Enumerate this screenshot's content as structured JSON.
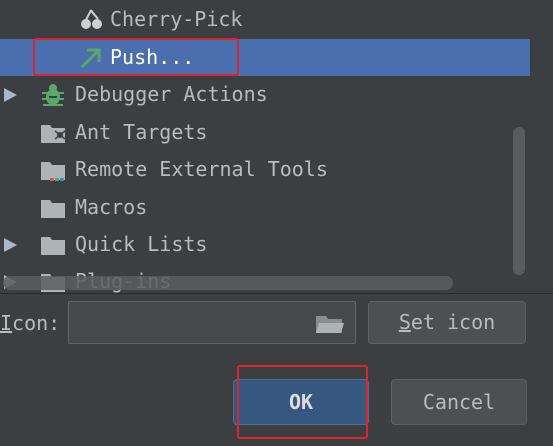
{
  "tree": {
    "items": [
      {
        "label": "Cherry-Pick",
        "icon": "cherry-icon",
        "expandable": false,
        "selected": false
      },
      {
        "label": "Push...",
        "icon": "push-arrow-icon",
        "expandable": false,
        "selected": true
      },
      {
        "label": "Debugger Actions",
        "icon": "bug-icon",
        "expandable": true,
        "selected": false
      },
      {
        "label": "Ant Targets",
        "icon": "ant-folder-icon",
        "expandable": false,
        "selected": false
      },
      {
        "label": "Remote External Tools",
        "icon": "external-tools-folder-icon",
        "expandable": false,
        "selected": false
      },
      {
        "label": "Macros",
        "icon": "folder-icon",
        "expandable": false,
        "selected": false
      },
      {
        "label": "Quick Lists",
        "icon": "folder-icon",
        "expandable": true,
        "selected": false
      },
      {
        "label": "Plug-ins",
        "icon": "folder-icon",
        "expandable": true,
        "selected": false
      }
    ]
  },
  "icon_field": {
    "label_mnemonic": "I",
    "label_rest": "con:",
    "value": ""
  },
  "buttons": {
    "set_icon_mnemonic": "S",
    "set_icon_rest": "et icon",
    "ok": "OK",
    "cancel": "Cancel"
  },
  "colors": {
    "background": "#3c3f41",
    "selection": "#4b6eaf",
    "highlight_box": "#e0242c",
    "default_button": "#365880"
  }
}
